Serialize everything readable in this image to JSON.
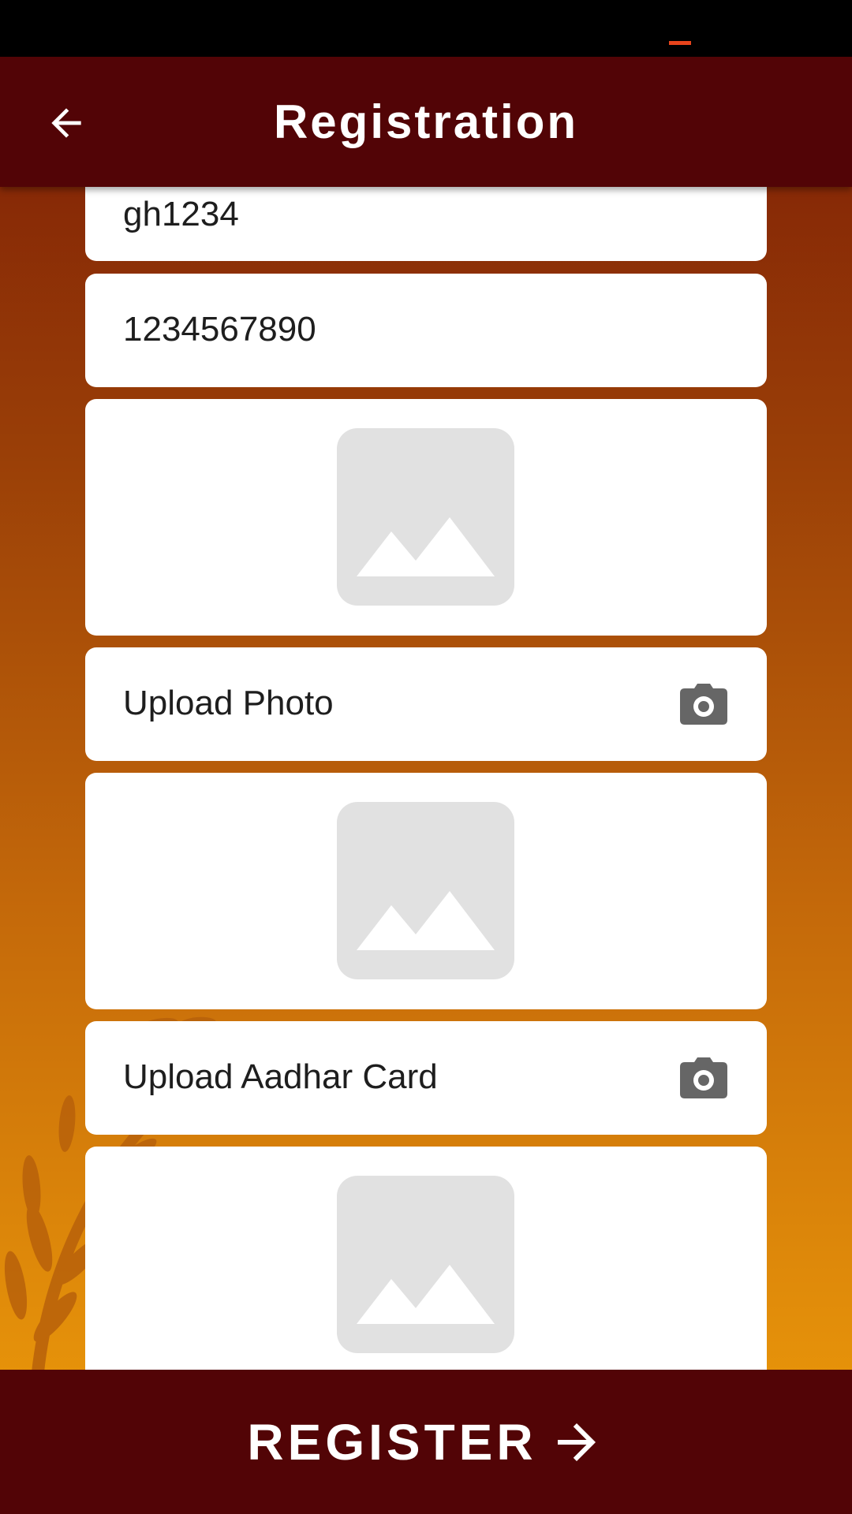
{
  "app_bar": {
    "title": "Registration",
    "back_icon": "arrow-back-icon"
  },
  "form": {
    "username_value": "gh1234",
    "phone_value": "1234567890",
    "upload_photo_label": "Upload Photo",
    "upload_aadhar_label": "Upload Aadhar Card",
    "camera_icon": "camera-icon",
    "image_placeholder_icon": "image-placeholder-icon"
  },
  "footer": {
    "register_label": "REGISTER",
    "register_icon": "arrow-forward-icon"
  },
  "colors": {
    "app_bar": "#520406",
    "background_top": "#7a1a06",
    "background_bottom": "#ef9d08",
    "card": "#ffffff",
    "placeholder": "#e1e1e1",
    "icon_gray": "#666666"
  }
}
